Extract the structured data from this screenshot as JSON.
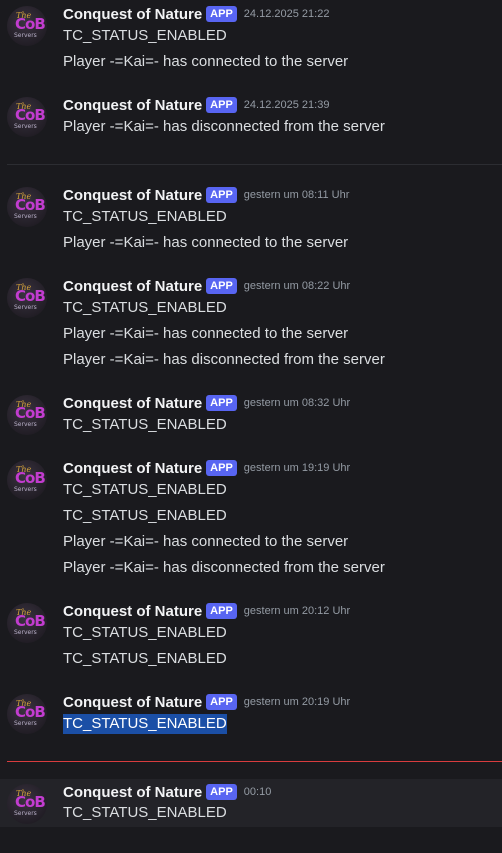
{
  "bot": {
    "name": "Conquest of Nature",
    "badge": "APP",
    "avatar_icon": "cob-servers-logo-icon",
    "avatar_lines": [
      "The",
      "CoB",
      "Servers"
    ]
  },
  "messages": [
    {
      "time": "24.12.2025 21:22",
      "lines": [
        "TC_STATUS_ENABLED",
        "Player -=Kai=- has connected to the server"
      ]
    },
    {
      "time": "24.12.2025 21:39",
      "lines": [
        "Player -=Kai=- has disconnected from the server"
      ]
    },
    {
      "time": "gestern um 08:11 Uhr",
      "lines": [
        "TC_STATUS_ENABLED",
        "Player -=Kai=- has connected to the server"
      ]
    },
    {
      "time": "gestern um 08:22 Uhr",
      "lines": [
        "TC_STATUS_ENABLED",
        "Player -=Kai=- has connected to the server",
        "Player -=Kai=- has disconnected from the server"
      ]
    },
    {
      "time": "gestern um 08:32 Uhr",
      "lines": [
        "TC_STATUS_ENABLED"
      ]
    },
    {
      "time": "gestern um 19:19 Uhr",
      "lines": [
        "TC_STATUS_ENABLED",
        "TC_STATUS_ENABLED",
        "Player -=Kai=- has connected to the server",
        "Player -=Kai=- has disconnected from the server"
      ]
    },
    {
      "time": "gestern um 20:12 Uhr",
      "lines": [
        "TC_STATUS_ENABLED",
        "TC_STATUS_ENABLED"
      ]
    },
    {
      "time": "gestern um 20:19 Uhr",
      "lines": [
        "TC_STATUS_ENABLED"
      ],
      "selected_line": 0
    },
    {
      "time": "00:10",
      "lines": [
        "TC_STATUS_ENABLED"
      ],
      "highlighted": true
    }
  ]
}
